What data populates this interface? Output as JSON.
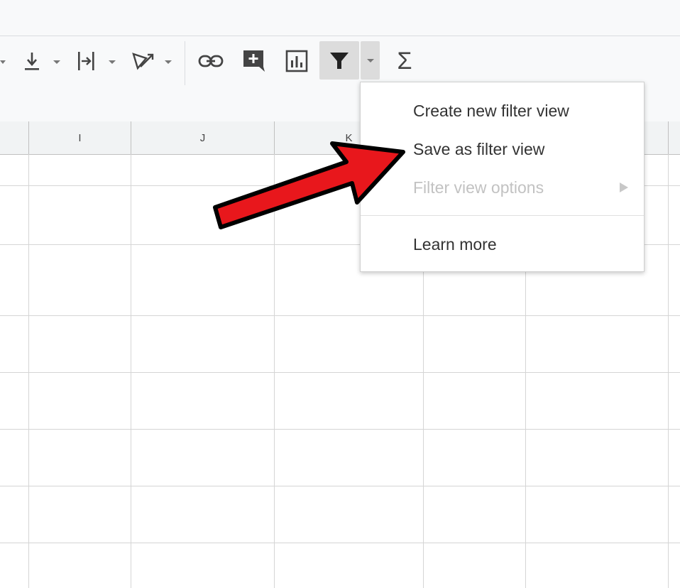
{
  "toolbar": {
    "icons": [
      "dropdown-caret-icon",
      "vertical-align-icon",
      "text-wrap-icon",
      "text-rotation-icon",
      "insert-link-icon",
      "insert-comment-icon",
      "insert-chart-icon",
      "filter-icon",
      "filter-dropdown-caret-icon",
      "functions-sigma-icon"
    ],
    "sigma_label": "Σ"
  },
  "grid": {
    "column_headers": [
      "I",
      "J",
      "K"
    ]
  },
  "menu": {
    "items": [
      {
        "label": "Create new filter view",
        "enabled": true
      },
      {
        "label": "Save as filter view",
        "enabled": true
      },
      {
        "label": "Filter view options",
        "enabled": false,
        "has_submenu": true
      },
      {
        "label": "Learn more",
        "enabled": true
      }
    ]
  },
  "colors": {
    "annotation_arrow": "#e8171c",
    "toolbar_bg": "#f8f9fa",
    "filter_active_bg": "#dcdcdc",
    "disabled_text": "#c2c2c2"
  }
}
